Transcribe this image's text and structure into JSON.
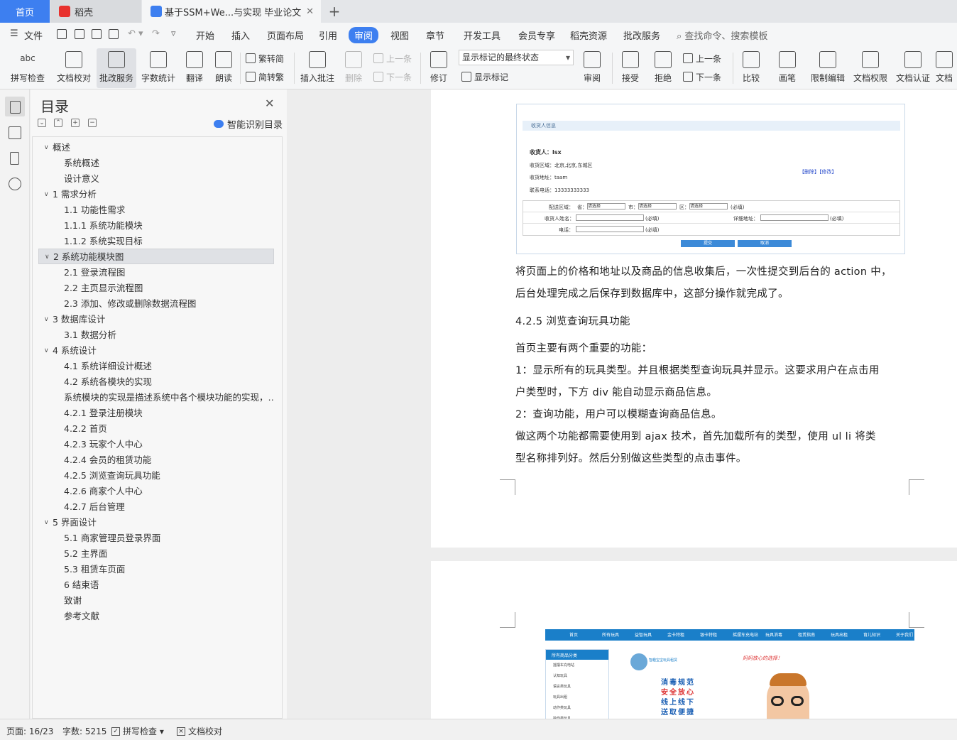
{
  "tabs": {
    "home": "首页",
    "daoke": "稻壳",
    "doc": "基于SSM+We...与实现 毕业论文",
    "add": "+",
    "close": "✕"
  },
  "menu": {
    "file": "文件",
    "items": [
      "开始",
      "插入",
      "页面布局",
      "引用",
      "审阅",
      "视图",
      "章节",
      "开发工具",
      "会员专享",
      "稻壳资源",
      "批改服务"
    ],
    "active": "审阅",
    "search": "查找命令、搜索模板"
  },
  "toolbar": {
    "spell": "拼写检查",
    "proof": "文档校对",
    "correct": "批改服务",
    "wordcount": "字数统计",
    "translate": "翻译",
    "read": "朗读",
    "trad": "繁转简",
    "simp": "简转繁",
    "insert_comment": "插入批注",
    "delete": "删除",
    "prev_comment": "上一条",
    "next_comment": "下一条",
    "track": "修订",
    "markup_state": "显示标记的最终状态",
    "show_markup": "显示标记",
    "review": "审阅",
    "accept": "接受",
    "reject": "拒绝",
    "prev_change": "上一条",
    "next_change": "下一条",
    "compare": "比较",
    "pen": "画笔",
    "restrict": "限制编辑",
    "rights": "文档权限",
    "auth": "文档认证",
    "more": "文档"
  },
  "toc": {
    "title": "目录",
    "smart": "智能识别目录",
    "close": "✕",
    "items": [
      {
        "text": "概述",
        "level": 1,
        "expand": true
      },
      {
        "text": "系统概述",
        "level": 2
      },
      {
        "text": "设计意义",
        "level": 2
      },
      {
        "text": "1  需求分析",
        "level": 1,
        "expand": true
      },
      {
        "text": "1.1  功能性需求",
        "level": 2
      },
      {
        "text": "1.1.1  系统功能模块",
        "level": 2
      },
      {
        "text": "1.1.2  系统实现目标",
        "level": 2
      },
      {
        "text": "2  系统功能模块图",
        "level": 1,
        "expand": true,
        "selected": true
      },
      {
        "text": "2.1  登录流程图",
        "level": 2
      },
      {
        "text": "2.2  主页显示流程图",
        "level": 2
      },
      {
        "text": "2.3  添加、修改或删除数据流程图",
        "level": 2
      },
      {
        "text": "3  数据库设计",
        "level": 1,
        "expand": true
      },
      {
        "text": "3.1  数据分析",
        "level": 2
      },
      {
        "text": "4  系统设计",
        "level": 1,
        "expand": true
      },
      {
        "text": "4.1  系统详细设计概述",
        "level": 2
      },
      {
        "text": "4.2 系统各模块的实现",
        "level": 2
      },
      {
        "text": "系统模块的实现是描述系统中各个模块功能的实现，…",
        "level": 2
      },
      {
        "text": "4.2.1  登录注册模块",
        "level": 2
      },
      {
        "text": "4.2.2  首页",
        "level": 2
      },
      {
        "text": "4.2.3  玩家个人中心",
        "level": 2
      },
      {
        "text": "4.2.4  会员的租赁功能",
        "level": 2
      },
      {
        "text": "4.2.5  浏览查询玩具功能",
        "level": 2
      },
      {
        "text": "4.2.6  商家个人中心",
        "level": 2
      },
      {
        "text": "4.2.7  后台管理",
        "level": 2
      },
      {
        "text": "5  界面设计",
        "level": 1,
        "expand": true
      },
      {
        "text": "5.1  商家管理员登录界面",
        "level": 2
      },
      {
        "text": "5.2  主界面",
        "level": 2
      },
      {
        "text": "5.3  租赁车页面",
        "level": 2
      },
      {
        "text": "6  结束语",
        "level": 2
      },
      {
        "text": "致谢",
        "level": 2
      },
      {
        "text": "参考文献",
        "level": 2
      }
    ]
  },
  "doc": {
    "p1": "将页面上的价格和地址以及商品的信息收集后，一次性提交到后台的 action 中，",
    "p2": "后台处理完成之后保存到数据库中，这部分操作就完成了。",
    "h": "4.2.5  浏览查询玩具功能",
    "p3": "首页主要有两个重要的功能：",
    "p4": "1：显示所有的玩具类型。并且根据类型查询玩具并显示。这要求用户在点击用",
    "p5": "户类型时，下方 div 能自动显示商品信息。",
    "p6": "2：查询功能，用户可以模糊查询商品信息。",
    "p7": "做这两个功能都需要使用到 ajax 技术，首先加载所有的类型，使用 ul li 将类",
    "p8": "型名称排列好。然后分别做这些类型的点击事件。",
    "shot1": {
      "header": "收货人信息",
      "name": "收货人：lsx",
      "region": "收货区域：北京,北京,东城区",
      "addr": "收货地址：taam",
      "phone": "联系电话：13333333333",
      "links": "【删除】【修改】",
      "f_region": "配送区域：",
      "f_prov": "省：",
      "f_city": "市：",
      "f_dist": "区：",
      "f_sel": "请选择",
      "f_req": "(必填)",
      "f_name": "收货人姓名：",
      "f_detail": "详细地址：",
      "f_phone": "电话：",
      "submit": "提交",
      "cancel": "取消"
    },
    "shot2": {
      "nav": [
        "首页",
        "所有玩具",
        "益智玩具",
        "金卡特租",
        "银卡特租",
        "摇摆车充电站",
        "玩具消毒",
        "租赁指南",
        "玩具出租",
        "育儿知识",
        "关于我们"
      ],
      "side_title": "所有商品分类",
      "side_items": [
        "摇摆车充电站",
        "认知玩具",
        "语言类玩具",
        "玩具出租",
        "动作类玩具",
        "操作类玩具"
      ],
      "logo": "智趣宝宝玩具租赁",
      "slogan": "妈妈放心的选择！",
      "h1": "消毒规范",
      "h2": "安全放心",
      "h3": "线上线下",
      "h4": "送取便捷"
    }
  },
  "status": {
    "page": "页面: 16/23",
    "words": "字数: 5215",
    "spell": "拼写检查",
    "proof": "文档校对"
  }
}
